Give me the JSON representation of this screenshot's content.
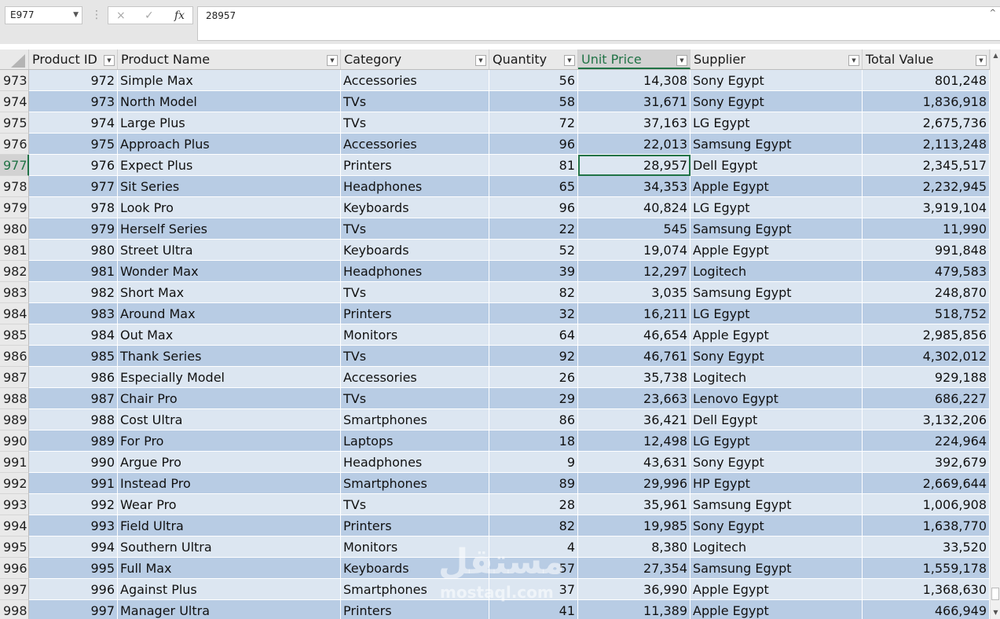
{
  "formula_bar": {
    "name_box": "E977",
    "cancel_icon": "×",
    "enter_icon": "✓",
    "fx_icon": "fx",
    "content": "28957",
    "collapse_icon": "^"
  },
  "columns": [
    "Product ID",
    "Product Name",
    "Category",
    "Quantity",
    "Unit Price",
    "Supplier",
    "Total Value"
  ],
  "selected_column": 4,
  "selected_row_number": "977",
  "rows": [
    {
      "rn": "973",
      "id": "972",
      "name": "Simple Max",
      "cat": "Accessories",
      "qty": "56",
      "price": "14,308",
      "sup": "Sony Egypt",
      "total": "801,248"
    },
    {
      "rn": "974",
      "id": "973",
      "name": "North Model",
      "cat": "TVs",
      "qty": "58",
      "price": "31,671",
      "sup": "Sony Egypt",
      "total": "1,836,918"
    },
    {
      "rn": "975",
      "id": "974",
      "name": "Large Plus",
      "cat": "TVs",
      "qty": "72",
      "price": "37,163",
      "sup": "LG Egypt",
      "total": "2,675,736"
    },
    {
      "rn": "976",
      "id": "975",
      "name": "Approach Plus",
      "cat": "Accessories",
      "qty": "96",
      "price": "22,013",
      "sup": "Samsung Egypt",
      "total": "2,113,248"
    },
    {
      "rn": "977",
      "id": "976",
      "name": "Expect Plus",
      "cat": "Printers",
      "qty": "81",
      "price": "28,957",
      "sup": "Dell Egypt",
      "total": "2,345,517"
    },
    {
      "rn": "978",
      "id": "977",
      "name": "Sit Series",
      "cat": "Headphones",
      "qty": "65",
      "price": "34,353",
      "sup": "Apple Egypt",
      "total": "2,232,945"
    },
    {
      "rn": "979",
      "id": "978",
      "name": "Look Pro",
      "cat": "Keyboards",
      "qty": "96",
      "price": "40,824",
      "sup": "LG Egypt",
      "total": "3,919,104"
    },
    {
      "rn": "980",
      "id": "979",
      "name": "Herself Series",
      "cat": "TVs",
      "qty": "22",
      "price": "545",
      "sup": "Samsung Egypt",
      "total": "11,990"
    },
    {
      "rn": "981",
      "id": "980",
      "name": "Street Ultra",
      "cat": "Keyboards",
      "qty": "52",
      "price": "19,074",
      "sup": "Apple Egypt",
      "total": "991,848"
    },
    {
      "rn": "982",
      "id": "981",
      "name": "Wonder Max",
      "cat": "Headphones",
      "qty": "39",
      "price": "12,297",
      "sup": "Logitech",
      "total": "479,583"
    },
    {
      "rn": "983",
      "id": "982",
      "name": "Short Max",
      "cat": "TVs",
      "qty": "82",
      "price": "3,035",
      "sup": "Samsung Egypt",
      "total": "248,870"
    },
    {
      "rn": "984",
      "id": "983",
      "name": "Around Max",
      "cat": "Printers",
      "qty": "32",
      "price": "16,211",
      "sup": "LG Egypt",
      "total": "518,752"
    },
    {
      "rn": "985",
      "id": "984",
      "name": "Out Max",
      "cat": "Monitors",
      "qty": "64",
      "price": "46,654",
      "sup": "Apple Egypt",
      "total": "2,985,856"
    },
    {
      "rn": "986",
      "id": "985",
      "name": "Thank Series",
      "cat": "TVs",
      "qty": "92",
      "price": "46,761",
      "sup": "Sony Egypt",
      "total": "4,302,012"
    },
    {
      "rn": "987",
      "id": "986",
      "name": "Especially Model",
      "cat": "Accessories",
      "qty": "26",
      "price": "35,738",
      "sup": "Logitech",
      "total": "929,188"
    },
    {
      "rn": "988",
      "id": "987",
      "name": "Chair Pro",
      "cat": "TVs",
      "qty": "29",
      "price": "23,663",
      "sup": "Lenovo Egypt",
      "total": "686,227"
    },
    {
      "rn": "989",
      "id": "988",
      "name": "Cost Ultra",
      "cat": "Smartphones",
      "qty": "86",
      "price": "36,421",
      "sup": "Dell Egypt",
      "total": "3,132,206"
    },
    {
      "rn": "990",
      "id": "989",
      "name": "For Pro",
      "cat": "Laptops",
      "qty": "18",
      "price": "12,498",
      "sup": "LG Egypt",
      "total": "224,964"
    },
    {
      "rn": "991",
      "id": "990",
      "name": "Argue Pro",
      "cat": "Headphones",
      "qty": "9",
      "price": "43,631",
      "sup": "Sony Egypt",
      "total": "392,679"
    },
    {
      "rn": "992",
      "id": "991",
      "name": "Instead Pro",
      "cat": "Smartphones",
      "qty": "89",
      "price": "29,996",
      "sup": "HP Egypt",
      "total": "2,669,644"
    },
    {
      "rn": "993",
      "id": "992",
      "name": "Wear Pro",
      "cat": "TVs",
      "qty": "28",
      "price": "35,961",
      "sup": "Samsung Egypt",
      "total": "1,006,908"
    },
    {
      "rn": "994",
      "id": "993",
      "name": "Field Ultra",
      "cat": "Printers",
      "qty": "82",
      "price": "19,985",
      "sup": "Sony Egypt",
      "total": "1,638,770"
    },
    {
      "rn": "995",
      "id": "994",
      "name": "Southern Ultra",
      "cat": "Monitors",
      "qty": "4",
      "price": "8,380",
      "sup": "Logitech",
      "total": "33,520"
    },
    {
      "rn": "996",
      "id": "995",
      "name": "Full Max",
      "cat": "Keyboards",
      "qty": "57",
      "price": "27,354",
      "sup": "Samsung Egypt",
      "total": "1,559,178"
    },
    {
      "rn": "997",
      "id": "996",
      "name": "Against Plus",
      "cat": "Smartphones",
      "qty": "37",
      "price": "36,990",
      "sup": "Apple Egypt",
      "total": "1,368,630"
    },
    {
      "rn": "998",
      "id": "997",
      "name": "Manager Ultra",
      "cat": "Printers",
      "qty": "41",
      "price": "11,389",
      "sup": "Apple Egypt",
      "total": "466,949"
    }
  ],
  "watermark": {
    "big": "مستقل",
    "small": "mostaql.com"
  }
}
